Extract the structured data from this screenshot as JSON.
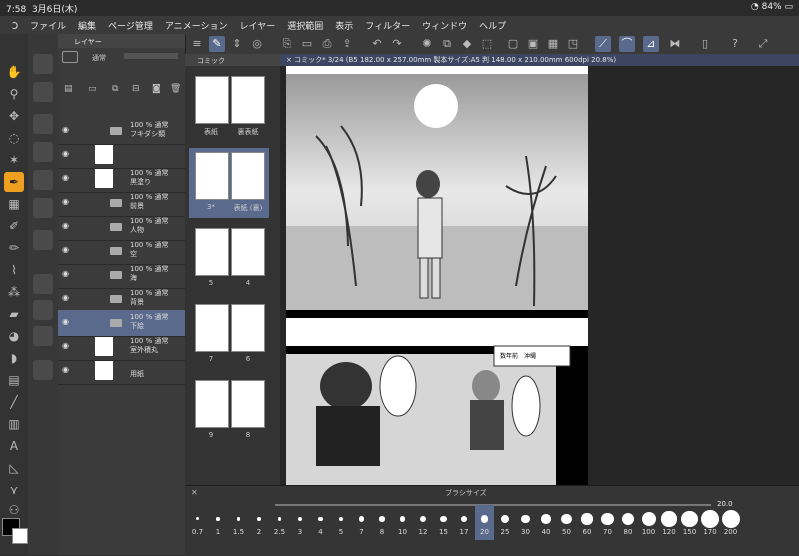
{
  "status_bar": {
    "time": "7:58",
    "date": "3月6日(木)",
    "battery": "84%"
  },
  "menu": [
    "ファイル",
    "編集",
    "ページ管理",
    "アニメーション",
    "レイヤー",
    "選択範囲",
    "表示",
    "フィルター",
    "ウィンドウ",
    "ヘルプ"
  ],
  "layer_panel": {
    "title": "レイヤー",
    "blend_mode": "通常",
    "layers": [
      {
        "line1": "100 % 通常",
        "line2": "フキダシ類",
        "type": "folder"
      },
      {
        "line1": "",
        "line2": "",
        "type": "mask"
      },
      {
        "line1": "100 % 通常",
        "line2": "黒塗り",
        "type": "raster"
      },
      {
        "line1": "100 % 通常",
        "line2": "前景",
        "type": "folder"
      },
      {
        "line1": "100 % 通常",
        "line2": "人物",
        "type": "folder"
      },
      {
        "line1": "100 % 通常",
        "line2": "空",
        "type": "folder"
      },
      {
        "line1": "100 % 通常",
        "line2": "海",
        "type": "folder"
      },
      {
        "line1": "100 % 通常",
        "line2": "背景",
        "type": "folder"
      },
      {
        "line1": "100 % 通常",
        "line2": "下絵",
        "type": "folder",
        "selected": true
      },
      {
        "line1": "100 % 通常",
        "line2": "室外積丸",
        "type": "raster"
      },
      {
        "line1": "",
        "line2": "用紙",
        "type": "paper"
      }
    ]
  },
  "page_panel": {
    "title": "コミック",
    "pages": [
      {
        "label": "表紙",
        "label2": "裏表紙"
      },
      {
        "label": "3*",
        "label2": "表紙 (裏)"
      },
      {
        "label": "5",
        "label2": "4"
      },
      {
        "label": "7",
        "label2": "6"
      },
      {
        "label": "9",
        "label2": "8"
      }
    ]
  },
  "canvas_tab": "コミック* 3/24 (B5 182.00 x 257.00mm 製本サイズ:A5 判 148.00 x 210.00mm 600dpi 20.8%)",
  "canvas_caption": "数年前　沖縄",
  "brush_panel": {
    "title": "ブラシサイズ",
    "current": "20.0",
    "sizes": [
      "0.7",
      "1",
      "1.5",
      "2",
      "2.5",
      "3",
      "4",
      "5",
      "7",
      "8",
      "10",
      "12",
      "15",
      "17",
      "20",
      "25",
      "30",
      "40",
      "50",
      "60",
      "70",
      "80",
      "100",
      "120",
      "150",
      "170",
      "200"
    ],
    "selected": "20"
  }
}
